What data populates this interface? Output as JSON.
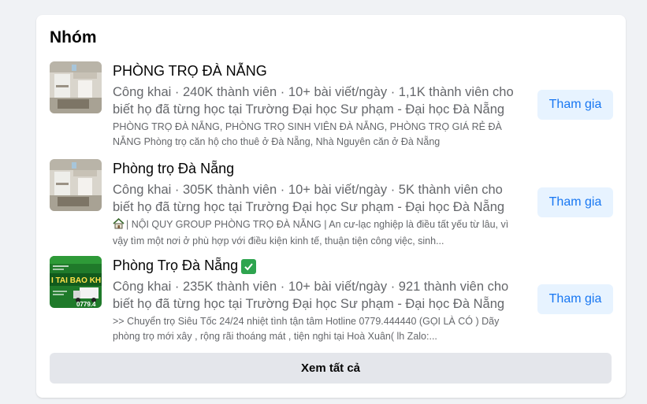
{
  "section": {
    "title": "Nhóm",
    "see_all_label": "Xem tất cả"
  },
  "groups": [
    {
      "name": "PHÒNG TRỌ ĐÀ NẴNG",
      "meta": "Công khai · 240K thành viên · 10+ bài viết/ngày · 1,1K thành viên cho biết họ đã từng học tại Trường Đại học Sư phạm - Đại học Đà Nẵng",
      "description": "PHÒNG TRỌ ĐÀ NẴNG, PHÒNG TRỌ SINH VIÊN ĐÀ NẴNG, PHÒNG TRỌ GIÁ RẺ ĐÀ NẴNG Phòng trọ căn hộ cho thuê ở Đà Nẵng, Nhà Nguyên căn ở Đà Nẵng",
      "join_label": "Tham gia",
      "thumbnail_icon": "room-interior-photo"
    },
    {
      "name": "Phòng trọ Đà Nẵng",
      "meta": "Công khai · 305K thành viên · 10+ bài viết/ngày · 5K thành viên cho biết họ đã từng học tại Trường Đại học Sư phạm - Đại học Đà Nẵng",
      "description": "| NỘI QUY GROUP PHÒNG TRỌ ĐÀ NẴNG | An cư-lạc nghiệp là điều tất yếu từ lâu, vì vậy tìm một nơi ở phù hợp với điều kiện kinh tế, thuận tiện công việc, sinh...",
      "join_label": "Tham gia",
      "thumbnail_icon": "room-interior-photo",
      "desc_icon": "house-icon"
    },
    {
      "name": "Phòng Trọ Đà Nẵng",
      "meta": "Công khai · 235K thành viên · 10+ bài viết/ngày · 921 thành viên cho biết họ đã từng học tại Trường Đại học Sư phạm - Đại học Đà Nẵng",
      "description": ">> Chuyển trọ Siêu Tốc 24/24 nhiệt tình tận tâm Hotline 0779.444440 (GỌI LÀ CÓ ) Dãy phòng trọ mới xây , rộng rãi thoáng mát , tiện nghi tại Hoà Xuân( lh Zalo:...",
      "join_label": "Tham gia",
      "thumbnail_icon": "moving-truck-banner",
      "thumb_text_main": "I TAI BAO KH",
      "thumb_text_phone": "0779.4",
      "name_badge_icon": "green-check-icon"
    }
  ],
  "colors": {
    "page_bg": "#f0f2f5",
    "card_bg": "#ffffff",
    "join_bg": "#e7f3ff",
    "join_text": "#1877f2",
    "see_all_bg": "#e4e6eb",
    "secondary_text": "#65676b",
    "check_green": "#2ea44f"
  }
}
